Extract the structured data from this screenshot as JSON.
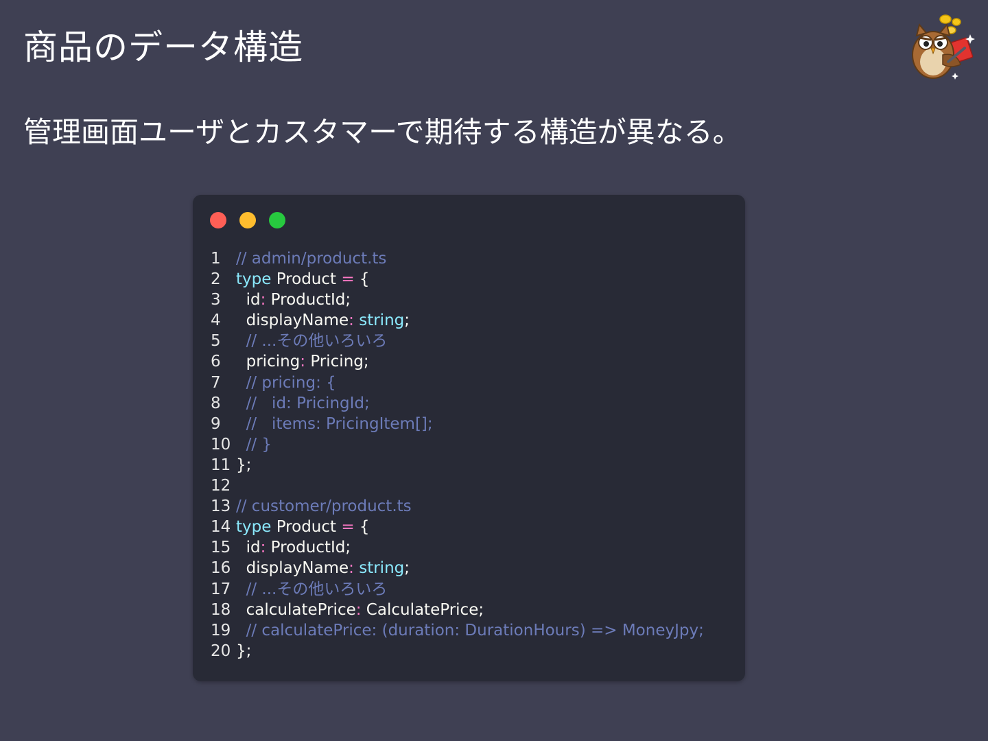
{
  "slide": {
    "title": "商品のデータ構造",
    "subtitle": "管理画面ユーザとカスタマーで期待する構造が異なる。"
  },
  "mascot": {
    "icon": "owl-mascot-icon"
  },
  "colors": {
    "background": "#3f4053",
    "code_background": "#282a36",
    "comment": "#6c7bb8",
    "keyword": "#8be9fd",
    "operator": "#ff79c6",
    "plain": "#f8f8f2",
    "traffic_red": "#ff5f56",
    "traffic_yellow": "#ffbd2e",
    "traffic_green": "#27c93f"
  },
  "code": {
    "lines": [
      {
        "n": "1",
        "tokens": [
          {
            "t": "comment",
            "v": "// admin/product.ts"
          }
        ]
      },
      {
        "n": "2",
        "tokens": [
          {
            "t": "keyword",
            "v": "type"
          },
          {
            "t": "plain",
            "v": " Product "
          },
          {
            "t": "op",
            "v": "="
          },
          {
            "t": "plain",
            "v": " {"
          }
        ]
      },
      {
        "n": "3",
        "tokens": [
          {
            "t": "plain",
            "v": "  id"
          },
          {
            "t": "op",
            "v": ":"
          },
          {
            "t": "plain",
            "v": " ProductId;"
          }
        ]
      },
      {
        "n": "4",
        "tokens": [
          {
            "t": "plain",
            "v": "  displayName"
          },
          {
            "t": "op",
            "v": ":"
          },
          {
            "t": "plain",
            "v": " "
          },
          {
            "t": "keyword",
            "v": "string"
          },
          {
            "t": "plain",
            "v": ";"
          }
        ]
      },
      {
        "n": "5",
        "tokens": [
          {
            "t": "comment",
            "v": "  // ...その他いろいろ"
          }
        ]
      },
      {
        "n": "6",
        "tokens": [
          {
            "t": "plain",
            "v": "  pricing"
          },
          {
            "t": "op",
            "v": ":"
          },
          {
            "t": "plain",
            "v": " Pricing;"
          }
        ]
      },
      {
        "n": "7",
        "tokens": [
          {
            "t": "comment",
            "v": "  // pricing: {"
          }
        ]
      },
      {
        "n": "8",
        "tokens": [
          {
            "t": "comment",
            "v": "  //   id: PricingId;"
          }
        ]
      },
      {
        "n": "9",
        "tokens": [
          {
            "t": "comment",
            "v": "  //   items: PricingItem[];"
          }
        ]
      },
      {
        "n": "10",
        "tokens": [
          {
            "t": "comment",
            "v": "  // }"
          }
        ]
      },
      {
        "n": "11",
        "tokens": [
          {
            "t": "plain",
            "v": "};"
          }
        ]
      },
      {
        "n": "12",
        "tokens": []
      },
      {
        "n": "13",
        "tokens": [
          {
            "t": "comment",
            "v": "// customer/product.ts"
          }
        ]
      },
      {
        "n": "14",
        "tokens": [
          {
            "t": "keyword",
            "v": "type"
          },
          {
            "t": "plain",
            "v": " Product "
          },
          {
            "t": "op",
            "v": "="
          },
          {
            "t": "plain",
            "v": " {"
          }
        ]
      },
      {
        "n": "15",
        "tokens": [
          {
            "t": "plain",
            "v": "  id"
          },
          {
            "t": "op",
            "v": ":"
          },
          {
            "t": "plain",
            "v": " ProductId;"
          }
        ]
      },
      {
        "n": "16",
        "tokens": [
          {
            "t": "plain",
            "v": "  displayName"
          },
          {
            "t": "op",
            "v": ":"
          },
          {
            "t": "plain",
            "v": " "
          },
          {
            "t": "keyword",
            "v": "string"
          },
          {
            "t": "plain",
            "v": ";"
          }
        ]
      },
      {
        "n": "17",
        "tokens": [
          {
            "t": "comment",
            "v": "  // ...その他いろいろ"
          }
        ]
      },
      {
        "n": "18",
        "tokens": [
          {
            "t": "plain",
            "v": "  calculatePrice"
          },
          {
            "t": "op",
            "v": ":"
          },
          {
            "t": "plain",
            "v": " CalculatePrice;"
          }
        ]
      },
      {
        "n": "19",
        "tokens": [
          {
            "t": "comment",
            "v": "  // calculatePrice: (duration: DurationHours) => MoneyJpy;"
          }
        ]
      },
      {
        "n": "20",
        "tokens": [
          {
            "t": "plain",
            "v": "};"
          }
        ]
      }
    ]
  }
}
